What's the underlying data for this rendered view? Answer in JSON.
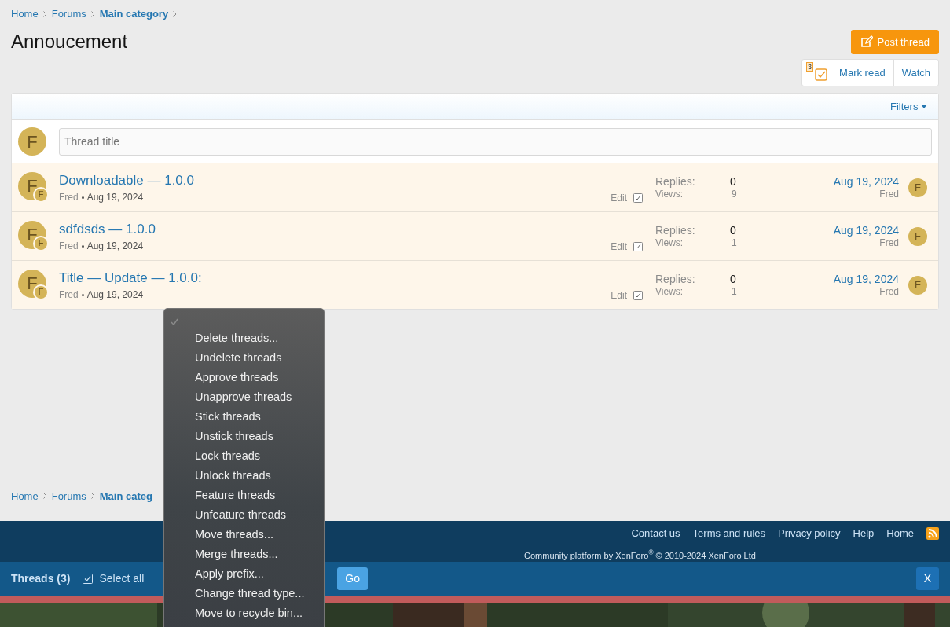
{
  "breadcrumb": [
    {
      "label": "Home",
      "current": false
    },
    {
      "label": "Forums",
      "current": false
    },
    {
      "label": "Main category",
      "current": true
    }
  ],
  "title": "Annoucement",
  "post_button": "Post thread",
  "actions": {
    "selected_count": "3",
    "buttons": [
      "Mark read",
      "Watch"
    ]
  },
  "filters": "Filters",
  "quick_thread": {
    "avatar": "F",
    "placeholder": "Thread title"
  },
  "threads": [
    {
      "avatar": "F",
      "badge": "F",
      "title": "Downloadable — 1.0.0",
      "author": "Fred",
      "date": "Aug 19, 2024",
      "edit": "Edit",
      "checked": true,
      "replies_label": "Replies:",
      "replies": "0",
      "views_label": "Views:",
      "views": "9",
      "last_date": "Aug 19, 2024",
      "last_user": "Fred",
      "last_avatar": "F"
    },
    {
      "avatar": "F",
      "badge": "F",
      "title": "sdfdsds — 1.0.0",
      "author": "Fred",
      "date": "Aug 19, 2024",
      "edit": "Edit",
      "checked": true,
      "replies_label": "Replies:",
      "replies": "0",
      "views_label": "Views:",
      "views": "1",
      "last_date": "Aug 19, 2024",
      "last_user": "Fred",
      "last_avatar": "F"
    },
    {
      "avatar": "F",
      "badge": "F",
      "title": "Title — Update — 1.0.0:",
      "author": "Fred",
      "date": "Aug 19, 2024",
      "edit": "Edit",
      "checked": true,
      "replies_label": "Replies:",
      "replies": "0",
      "views_label": "Views:",
      "views": "1",
      "last_date": "Aug 19, 2024",
      "last_user": "Fred",
      "last_avatar": "F"
    }
  ],
  "footer_breadcrumb": [
    {
      "label": "Home",
      "current": false
    },
    {
      "label": "Forums",
      "current": false
    },
    {
      "label": "Main categ",
      "current": true
    }
  ],
  "footer_links": [
    "Contact us",
    "Terms and rules",
    "Privacy policy",
    "Help",
    "Home"
  ],
  "copyright": "Community platform by XenForo$^{®}$ © 2010-2024 XenForo Ltd",
  "mod_bar": {
    "label": "Threads (3)",
    "select_all": "Select all",
    "select_all_checked": true,
    "go": "Go",
    "close": "X"
  },
  "action_menu": {
    "blank_selected": true,
    "options": [
      {
        "label": "Delete threads...",
        "selected": false
      },
      {
        "label": "Undelete threads",
        "selected": false
      },
      {
        "label": "Approve threads",
        "selected": false
      },
      {
        "label": "Unapprove threads",
        "selected": false
      },
      {
        "label": "Stick threads",
        "selected": false
      },
      {
        "label": "Unstick threads",
        "selected": false
      },
      {
        "label": "Lock threads",
        "selected": false
      },
      {
        "label": "Unlock threads",
        "selected": false
      },
      {
        "label": "Feature threads",
        "selected": false
      },
      {
        "label": "Unfeature threads",
        "selected": false
      },
      {
        "label": "Move threads...",
        "selected": false
      },
      {
        "label": "Merge threads...",
        "selected": false
      },
      {
        "label": "Apply prefix...",
        "selected": false
      },
      {
        "label": "Change thread type...",
        "selected": false
      },
      {
        "label": "Move to recycle bin...",
        "selected": false
      }
    ]
  }
}
